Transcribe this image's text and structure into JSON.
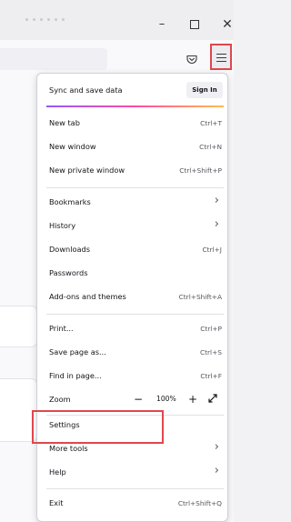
{
  "window": {
    "minimize_glyph": "–",
    "close_glyph": "✕"
  },
  "toolbar": {
    "pocket_icon": "pocket-icon",
    "menu_icon": "hamburger-menu-icon",
    "highlight_color": "#e0474c"
  },
  "menu": {
    "sync": {
      "label": "Sync and save data",
      "button": "Sign In"
    },
    "items": [
      {
        "label": "New tab",
        "shortcut": "Ctrl+T"
      },
      {
        "label": "New window",
        "shortcut": "Ctrl+N"
      },
      {
        "label": "New private window",
        "shortcut": "Ctrl+Shift+P"
      },
      {
        "label": "Bookmarks",
        "arrow": "›"
      },
      {
        "label": "History",
        "arrow": "›"
      },
      {
        "label": "Downloads",
        "shortcut": "Ctrl+J"
      },
      {
        "label": "Passwords"
      },
      {
        "label": "Add-ons and themes",
        "shortcut": "Ctrl+Shift+A"
      },
      {
        "label": "Print...",
        "shortcut": "Ctrl+P"
      },
      {
        "label": "Save page as...",
        "shortcut": "Ctrl+S"
      },
      {
        "label": "Find in page...",
        "shortcut": "Ctrl+F"
      },
      {
        "label": "Zoom",
        "minus": "−",
        "value": "100%",
        "plus": "+"
      },
      {
        "label": "Settings"
      },
      {
        "label": "More tools",
        "arrow": "›"
      },
      {
        "label": "Help",
        "arrow": "›"
      },
      {
        "label": "Exit",
        "shortcut": "Ctrl+Shift+Q"
      }
    ]
  }
}
